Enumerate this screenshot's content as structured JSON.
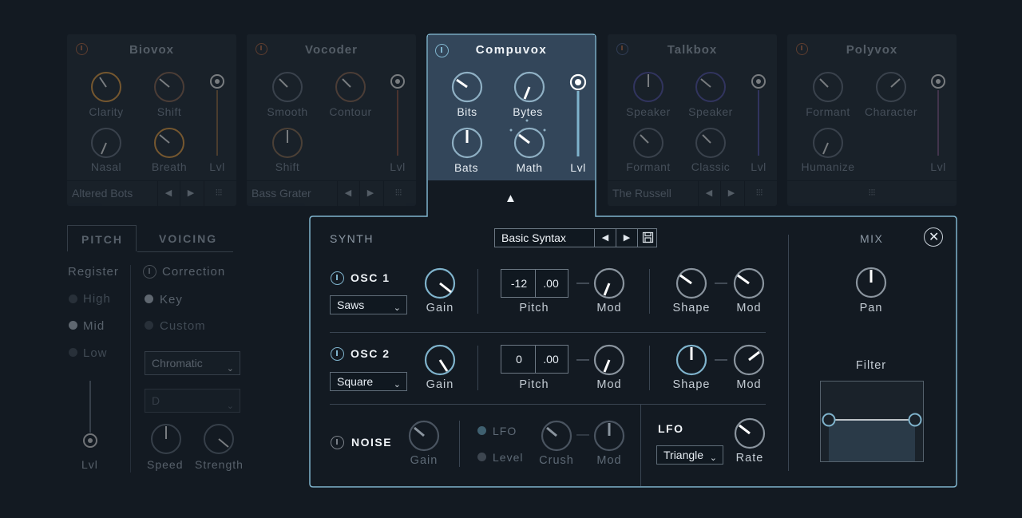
{
  "voice_cards": [
    {
      "name": "Biovox",
      "knobs": [
        "Clarity",
        "Shift",
        "Nasal",
        "Breath"
      ],
      "fader": "Lvl",
      "preset": "Altered Bots"
    },
    {
      "name": "Vocoder",
      "knobs": [
        "Smooth",
        "Contour",
        "Shift"
      ],
      "fader": "Lvl",
      "preset": "Bass Grater"
    },
    {
      "name": "Compuvox",
      "knobs": [
        "Bits",
        "Bytes",
        "Bats",
        "Math"
      ],
      "fader": "Lvl"
    },
    {
      "name": "Talkbox",
      "knobs": [
        "Speaker",
        "Speaker",
        "Formant",
        "Classic"
      ],
      "fader": "Lvl",
      "preset": "The Russell"
    },
    {
      "name": "Polyvox",
      "knobs": [
        "Formant",
        "Character",
        "Humanize"
      ],
      "fader": "Lvl"
    }
  ],
  "left_panel": {
    "tabs": [
      "PITCH",
      "VOICING"
    ],
    "register_label": "Register",
    "register_options": [
      "High",
      "Mid",
      "Low"
    ],
    "correction_label": "Correction",
    "correction_options": [
      "Key",
      "Custom"
    ],
    "scale_select": "Chromatic",
    "key_select": "D",
    "lvl_label": "Lvl",
    "speed_label": "Speed",
    "strength_label": "Strength"
  },
  "synth": {
    "section_label": "SYNTH",
    "preset": "Basic Syntax",
    "mix_label": "MIX",
    "osc1": {
      "label": "OSC 1",
      "wave": "Saws",
      "gain": "Gain",
      "pitch_int": "-12",
      "pitch_frac": ".00",
      "pitch": "Pitch",
      "mod": "Mod",
      "shape": "Shape",
      "mod2": "Mod"
    },
    "osc2": {
      "label": "OSC 2",
      "wave": "Square",
      "gain": "Gain",
      "pitch_int": "0",
      "pitch_frac": ".00",
      "pitch": "Pitch",
      "mod": "Mod",
      "shape": "Shape",
      "mod2": "Mod"
    },
    "noise": {
      "label": "NOISE",
      "gain": "Gain",
      "lfo_opt": "LFO",
      "level_opt": "Level",
      "crush": "Crush",
      "mod": "Mod"
    },
    "lfo": {
      "label": "LFO",
      "wave": "Triangle",
      "rate": "Rate"
    },
    "pan": "Pan",
    "filter": "Filter"
  },
  "colors": {
    "accent": "#7fb3cc",
    "bg": "#131a22",
    "card": "#1e2730"
  }
}
